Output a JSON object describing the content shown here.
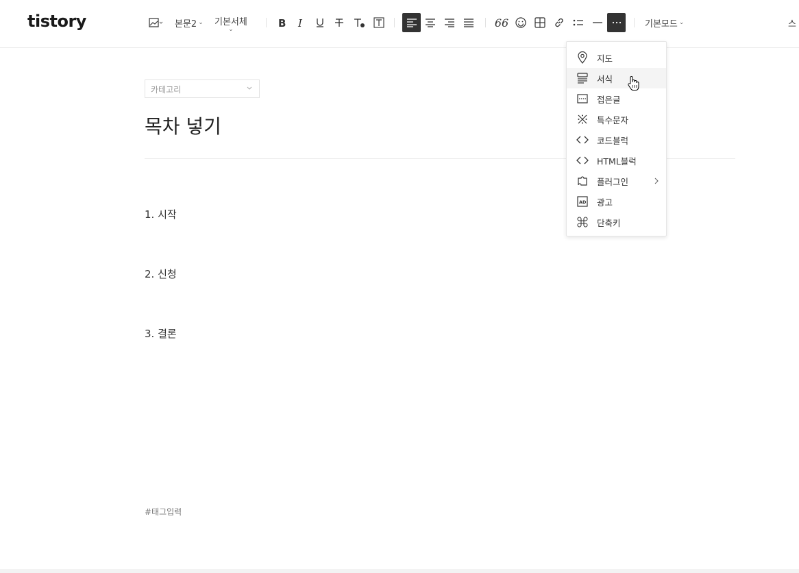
{
  "app": {
    "logo": "tistory"
  },
  "toolbar": {
    "paragraph_style": "본문2",
    "font_family": "기본서체",
    "mode": "기본모드",
    "right_cut": "스",
    "quote_glyph": "66"
  },
  "editor": {
    "category_placeholder": "카테고리",
    "title": "목차 넣기",
    "paragraphs": [
      "1. 시작",
      "2. 신청",
      "3. 결론"
    ],
    "tag_placeholder": "#태그입력"
  },
  "more_menu": {
    "items": [
      {
        "label": "지도",
        "icon": "map-pin-icon"
      },
      {
        "label": "서식",
        "icon": "template-icon"
      },
      {
        "label": "접은글",
        "icon": "fold-text-icon"
      },
      {
        "label": "특수문자",
        "icon": "special-char-icon"
      },
      {
        "label": "코드블럭",
        "icon": "code-icon"
      },
      {
        "label": "HTML블럭",
        "icon": "html-icon"
      },
      {
        "label": "플러그인",
        "icon": "plugin-icon"
      },
      {
        "label": "광고",
        "icon": "ad-icon"
      },
      {
        "label": "단축키",
        "icon": "command-icon"
      }
    ],
    "hovered_item": "서식"
  },
  "colors": {
    "active_button_bg": "#333333",
    "menu_hover_bg": "#f4f4f4",
    "text": "#333333"
  }
}
